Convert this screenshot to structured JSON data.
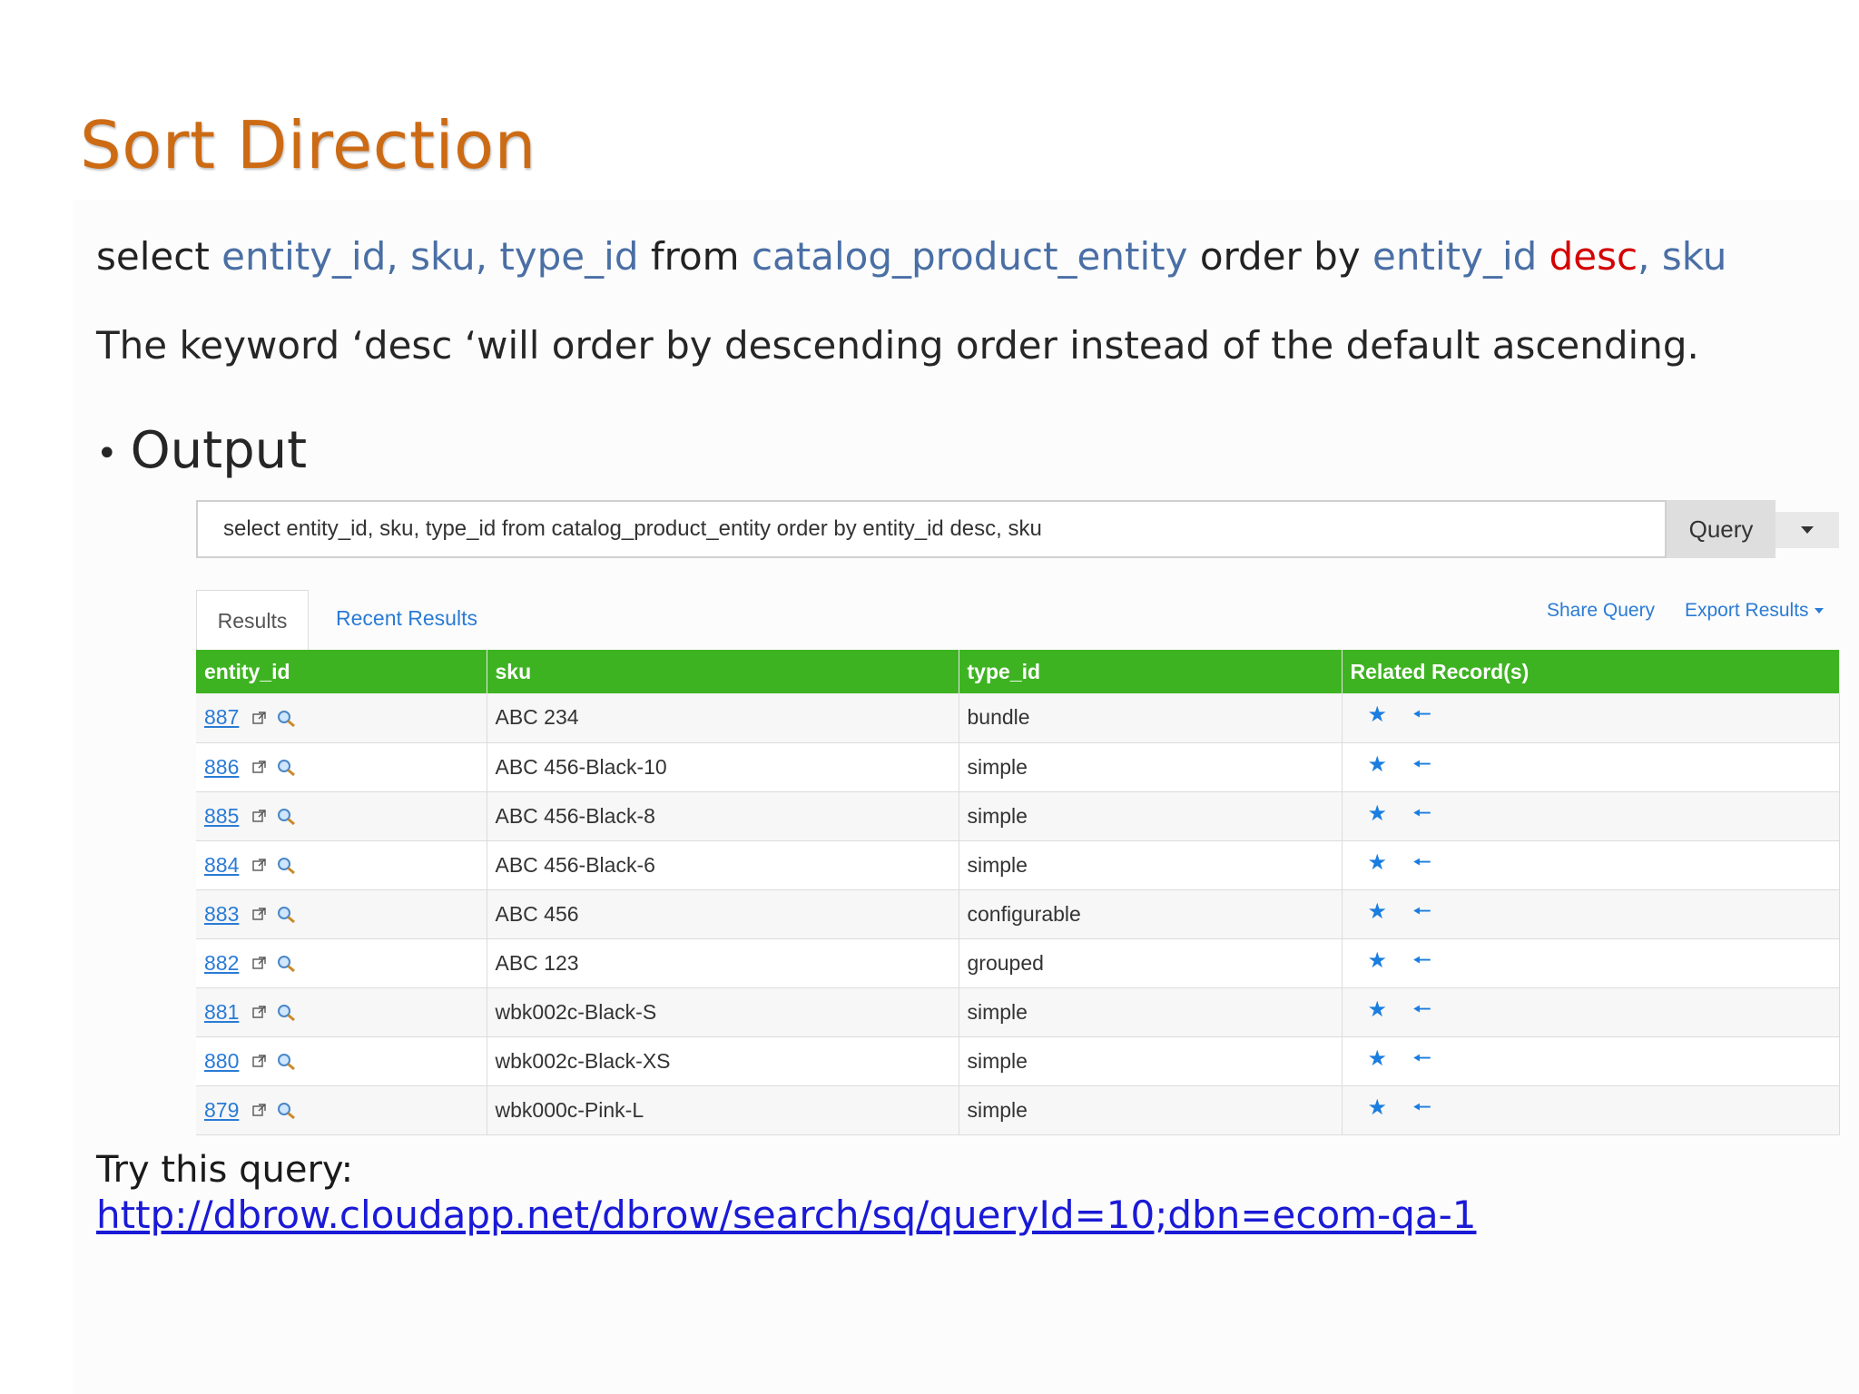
{
  "slide": {
    "title": "Sort Direction",
    "sql": {
      "select_kw": "select ",
      "columns": "entity_id, sku, type_id",
      "from_kw": " from ",
      "table": "catalog_product_entity",
      "order_kw": " order by ",
      "order_col": "entity_id",
      "desc_kw": " desc",
      "sep": ", ",
      "order_col2": "sku"
    },
    "description": "The keyword ‘desc ‘will order by descending order instead of the default ascending.",
    "bullet_label": "Output",
    "try_label": "Try this query:",
    "try_link": "http://dbrow.cloudapp.net/dbrow/search/sq/queryId=10;dbn=ecom-qa-1"
  },
  "query_bar": {
    "value": "select entity_id, sku, type_id from catalog_product_entity order by entity_id desc, sku",
    "button_label": "Query"
  },
  "tabs": {
    "results": "Results",
    "recent": "Recent Results"
  },
  "actions": {
    "share": "Share Query",
    "export": "Export Results"
  },
  "table": {
    "headers": [
      "entity_id",
      "sku",
      "type_id",
      "Related Record(s)"
    ],
    "rows": [
      {
        "entity_id": "887",
        "sku": "ABC 234",
        "type_id": "bundle"
      },
      {
        "entity_id": "886",
        "sku": "ABC 456-Black-10",
        "type_id": "simple"
      },
      {
        "entity_id": "885",
        "sku": "ABC 456-Black-8",
        "type_id": "simple"
      },
      {
        "entity_id": "884",
        "sku": "ABC 456-Black-6",
        "type_id": "simple"
      },
      {
        "entity_id": "883",
        "sku": "ABC 456",
        "type_id": "configurable"
      },
      {
        "entity_id": "882",
        "sku": "ABC 123",
        "type_id": "grouped"
      },
      {
        "entity_id": "881",
        "sku": "wbk002c-Black-S",
        "type_id": "simple"
      },
      {
        "entity_id": "880",
        "sku": "wbk002c-Black-XS",
        "type_id": "simple"
      },
      {
        "entity_id": "879",
        "sku": "wbk000c-Pink-L",
        "type_id": "simple"
      }
    ]
  },
  "icons": {
    "open": "external-link-icon",
    "inspect": "magnifier-icon",
    "related": "star-icon",
    "back": "left-arrow-icon"
  },
  "colors": {
    "title": "#cc6b14",
    "header_green": "#3eb322",
    "link_blue": "#2a7bd5",
    "desc_red": "#d40000"
  }
}
